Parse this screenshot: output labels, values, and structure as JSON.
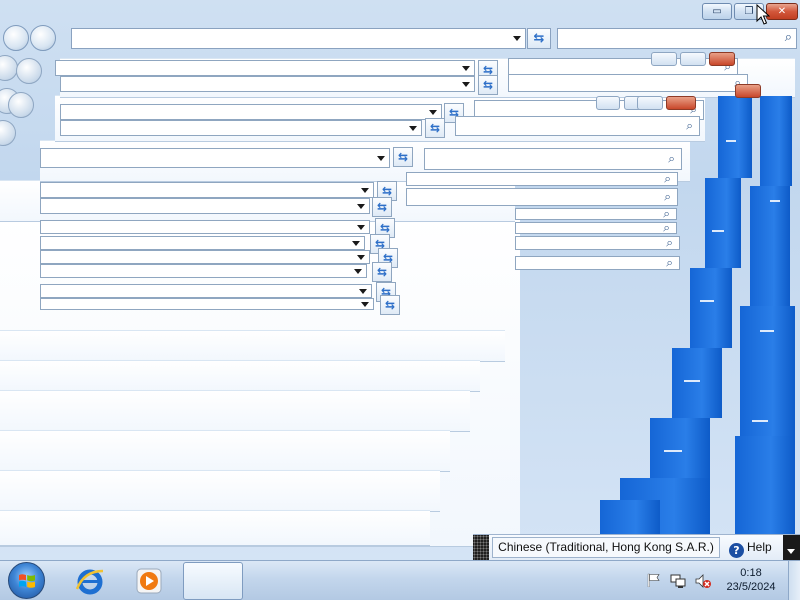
{
  "window": {
    "minimize_label": "▭",
    "restore_label": "❐",
    "close_label": "✕"
  },
  "browser": {
    "address_value": "",
    "search_value": "",
    "refresh_glyph": "⇆",
    "search_glyph": "⌕"
  },
  "language_bar": {
    "language": "Chinese (Traditional, Hong Kong S.A.R.)",
    "help_label": "Help",
    "help_glyph": "?"
  },
  "taskbar": {
    "time": "0:18",
    "date": "23/5/2024"
  },
  "icons": {
    "start": "windows-logo",
    "browser": "internet-explorer",
    "media": "windows-media-player",
    "tray": [
      "action-center-flag",
      "network",
      "volume-muted"
    ]
  },
  "colors": {
    "desktop_bg": "#c2d7ee",
    "glitch_blue": "#1566d6",
    "close_red": "#c13f22",
    "taskbar": "#c3d6ec"
  }
}
